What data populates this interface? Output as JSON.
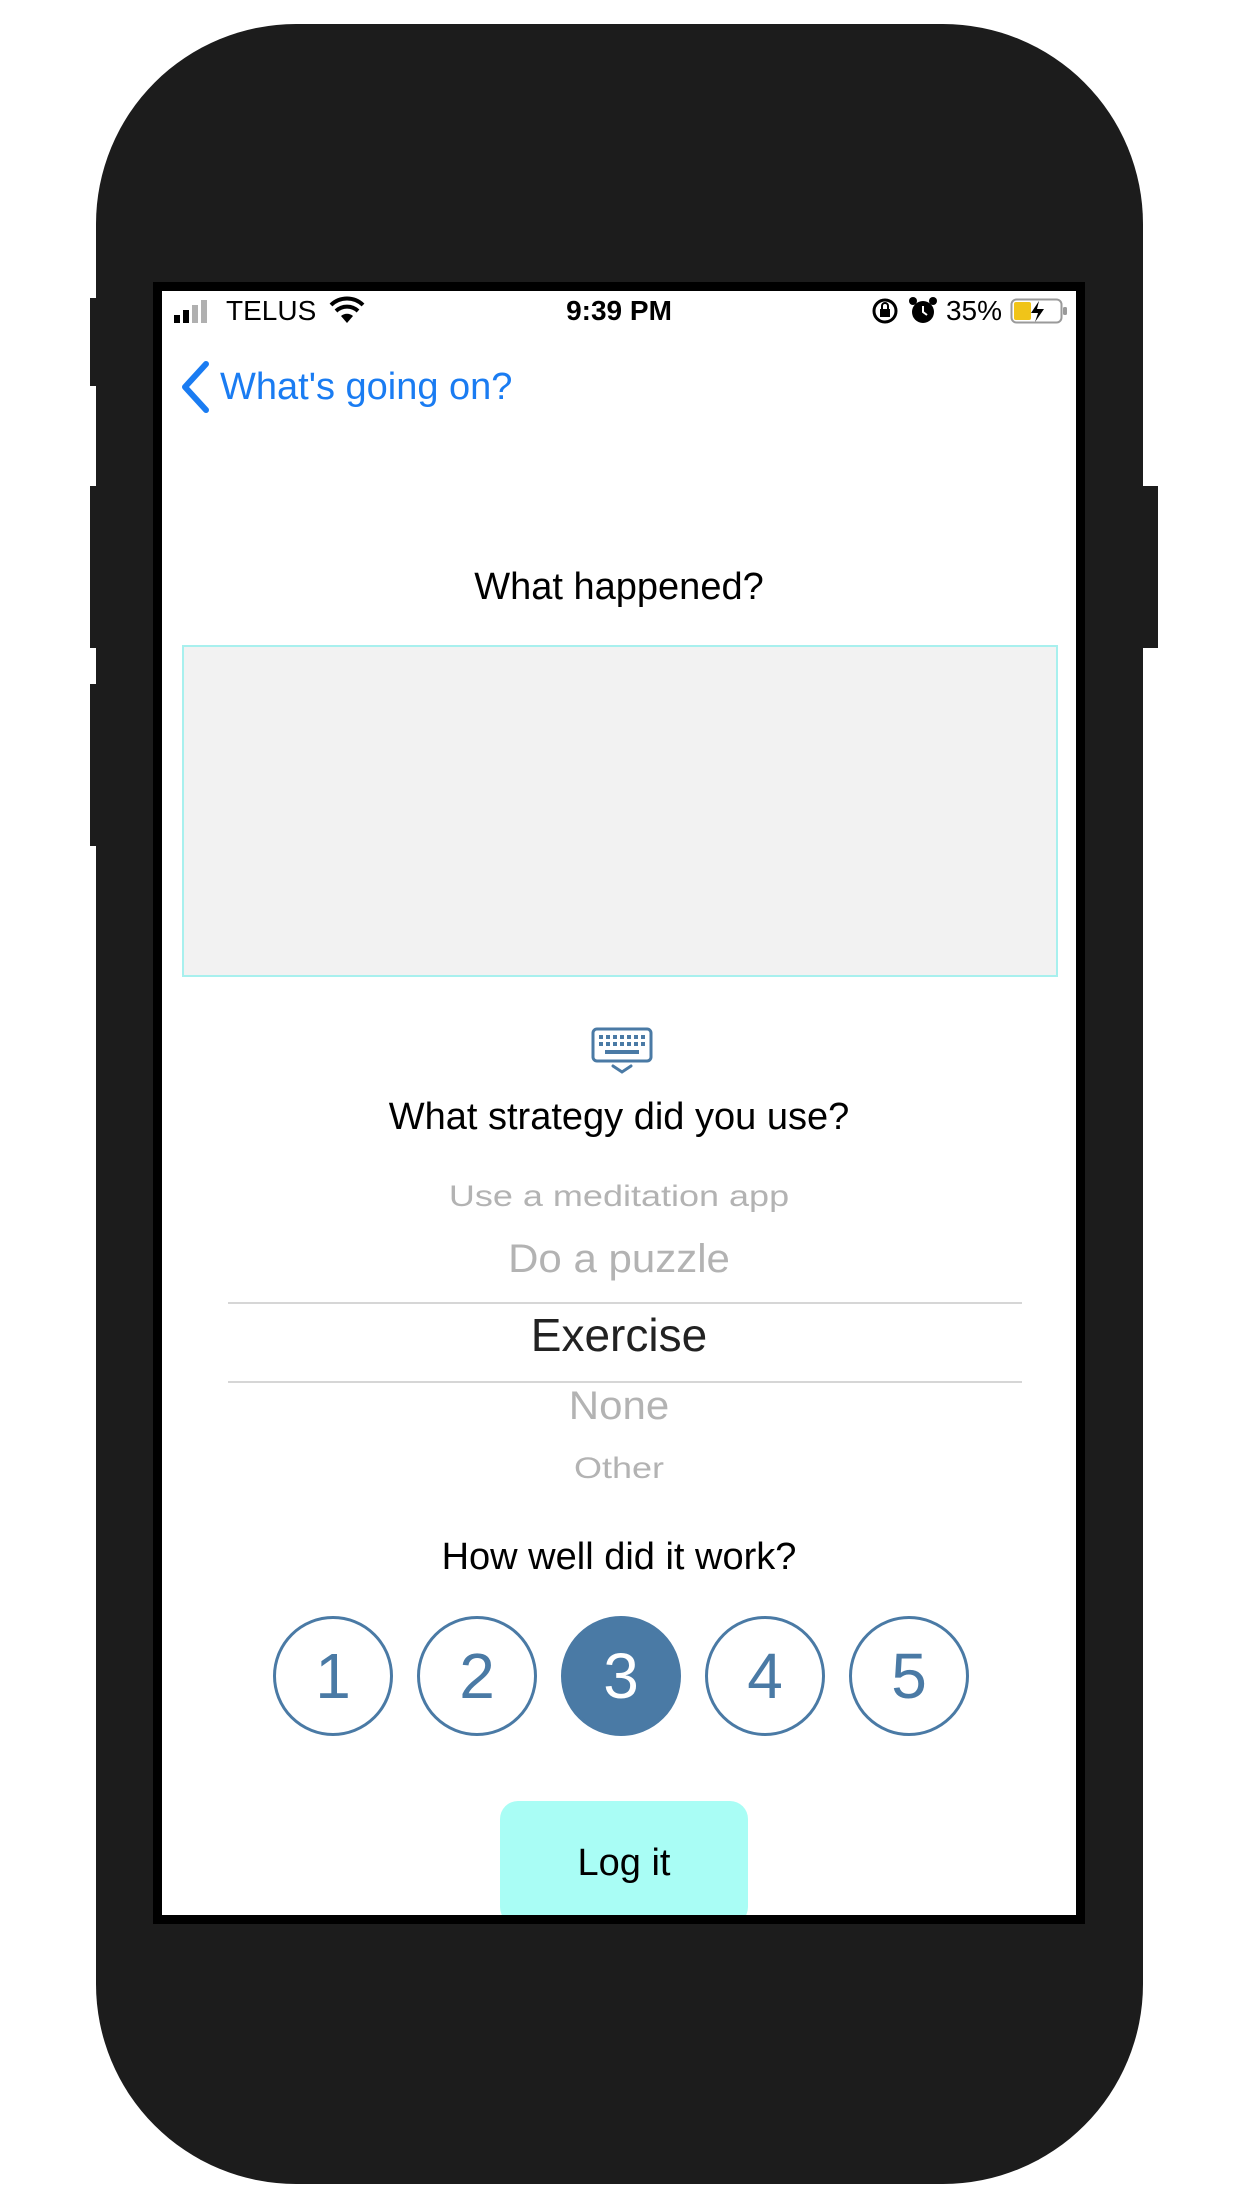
{
  "status_bar": {
    "carrier": "TELUS",
    "time": "9:39 PM",
    "battery_percent": "35%"
  },
  "nav": {
    "back_label": "What's going on?"
  },
  "form": {
    "what_happened_label": "What happened?",
    "notes_value": "",
    "strategy_label": "What strategy did you use?",
    "strategy_options": [
      "Use a meditation app",
      "Do a puzzle",
      "Exercise",
      "None",
      "Other"
    ],
    "selected_strategy": "Exercise",
    "rating_label": "How well did it work?",
    "ratings": [
      "1",
      "2",
      "3",
      "4",
      "5"
    ],
    "selected_rating": 3,
    "submit_label": "Log it"
  },
  "colors": {
    "accent_blue": "#1a7cf2",
    "rating_blue": "#4a7aa5",
    "button_bg": "#a9fdf5",
    "text_area_bg": "#f2f2f2",
    "text_area_border": "#a8f0ee",
    "phone_frame": "#1c1c1c"
  },
  "icons": {
    "back": "chevron-left-icon",
    "keyboard": "keyboard-dismiss-icon",
    "wifi": "wifi-icon",
    "signal": "cellular-signal-icon",
    "lock_rotation": "orientation-lock-icon",
    "alarm": "alarm-icon",
    "battery": "battery-charging-icon"
  }
}
